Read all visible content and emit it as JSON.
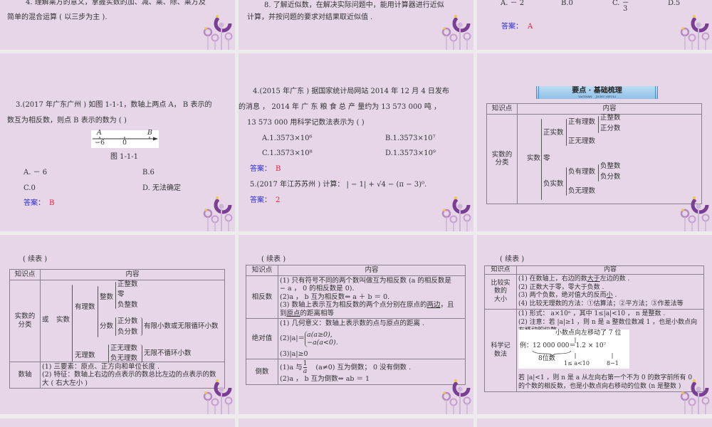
{
  "slide1": {
    "line1": "4. 理解乘方的意义，掌握实数的加、减、乘、除、乘方及",
    "line2": "简单的混合运算 ( 以三步为主 )."
  },
  "slide2": {
    "line1": "8. 了解近似数，在解决实际问题中，能用计算器进行近似",
    "line2": "计算，并按问题的要求对结果取近似值 ."
  },
  "slide3": {
    "optA": "A. － 2",
    "optB": "B.0",
    "optC": "C. －",
    "optC_den": "3",
    "optD": "D.5",
    "answer_label": "答案：",
    "answer": "A"
  },
  "slide4": {
    "q1": "3.(2017  年广东广州 ) 如图   1-1-1，数轴上两点   A， B  表示的",
    "q2": "数互为相反数，则点   B  表示的数为 (    )",
    "fig_A": "A",
    "fig_B": "B",
    "fig_m6": "−6",
    "fig_0": "0",
    "caption": "图   1-1-1",
    "optA": "A. － 6",
    "optB": "B.6",
    "optC": "C.0",
    "optD": "D. 无法确定",
    "answer_label": "答案：",
    "answer": "B"
  },
  "slide5": {
    "q1": "4.(2015  年广东 ) 据国家统计局网站   2014  年   12  月   4  日发布",
    "q2": "的消息 ，   2014  年  广  东  粮  食  总  产  量约为   13 573 000  吨 ，",
    "q3": "13 573 000  用科学记数法表示为 (       )",
    "optA": "A.1.3573×10⁶",
    "optB": "B.1.3573×10⁷",
    "optC": "C.1.3573×10⁸",
    "optD": "D.1.3573×10⁹",
    "answer_label": "答案：",
    "answer": "B",
    "q5": "5.(2017  年江苏苏州 ) 计算：  | − 1| + √4    − (π − 3)⁰.",
    "answer5": "2"
  },
  "slide6": {
    "banner": "要点 · 基础梳理",
    "banner_sub1": "YAODIAN",
    "banner_sub2": "JICHU SHULI",
    "h1": "知识点",
    "h2": "内容",
    "row": "实数的\n分类",
    "real": "实数",
    "pos": "正实数",
    "zero": "零",
    "neg": "负实数",
    "posrat": "正有理数",
    "posint": "正整数",
    "posfrac": "正分数",
    "posirr": "正无理数",
    "negrat": "负有理数",
    "negint": "负整数",
    "negfrac": "负分数",
    "negirr": "负无理数"
  },
  "slide7": {
    "cont": "( 续表 )",
    "h1": "知识点",
    "h2": "内容",
    "row1": "实数的\n分类",
    "or": "或",
    "real": "实数",
    "rat": "有理数",
    "int": "整数",
    "posint": "正整数",
    "zero": "零",
    "negint": "负整数",
    "frac": "分数",
    "posfrac": "正分数",
    "negfrac": "负分数",
    "finite": "有限小数或无限循环小数",
    "irr": "无理数",
    "posirr": "正无理数",
    "negirr": "负无理数",
    "infinite": "无限不循环小数",
    "row2": "数轴",
    "l1": "(1) 三要素：原点、正方向和单位长度 .",
    "l2": "(2) 特征：数轴上右边的点表示的数总比左边的点表示的数",
    "l3": "大 ( 右大左小 )"
  },
  "slide8": {
    "cont": "( 续表 )",
    "h1": "知识点",
    "h2": "内容",
    "r1": "相反数",
    "r1l1": "(1) 只有符号不同的两个数叫做互为相反数 (a  的相反数是",
    "r1l2": "  − a ， 0  的相反数是   0).",
    "r1l3": "(2)a ，  b  互为相反数⇔ a ＋ b ＝ 0.",
    "r1l4a": "(3) 数轴上表示互为相反数的两个点分别在原点的",
    "r1l4u": "两边",
    "r1l4b": "，且",
    "r1l5a": "到",
    "r1l5u": "原点",
    "r1l5b": "的距离相等",
    "r2": "绝对值",
    "r2l1": "(1) 几何意义：数轴上表示数的点与原点的距离 .",
    "r2l2": "(2)|a|＝",
    "r2c1": "a(a≥0),",
    "r2c2": "−a(a<0).",
    "r2l3": "(3)|a|≥0",
    "r3": "倒数",
    "r3l1a": "(1)a  与",
    "r3num": "1",
    "r3den": "a",
    "r3l1b": "(a≠0) 互为倒数；  0  没有倒数 .",
    "r3l2": "(2)a ，  b  互为倒数⇔ ab ＝ 1"
  },
  "slide9": {
    "cont": "( 续表 )",
    "h1": "知识点",
    "h2": "内容",
    "r1": "比较实\n数的\n大小",
    "r1l1a": "(1) 在数轴上，右边的数",
    "r1l1u": "大于",
    "r1l1b": "左边的数 .",
    "r1l2": "(2) 正数大于零，零大于负数 .",
    "r1l3a": "(3) 两个负数，绝对值大的反而",
    "r1l3u": "小",
    "r1l3b": " .",
    "r1l4": "(4) 比较无理数的方法：①估算法；②平方法；③作差法等",
    "r2": "科学记\n数法",
    "r2l1": "(1) 形式：  a×10ⁿ  ，其中   1≤|a|<10 ，  n  是整数 .",
    "r2l2": "(2) 注意：若 |a|≥1 ，则   n  是   a  整数位数减   1 ，也是小数点向",
    "r2l3": "右移动的位数 .",
    "ex_top": "小数点向左移动了 7 位",
    "ex_main": "例：12 000 000＝1.2   ×   10⁷",
    "ex_8": "8位数",
    "ex_range": "1≤ a<10",
    "ex_81": "8−1",
    "r2l4": "若 |a|<1 ，则   n  是   a  从左向右第一个不为   0  的数字前所有   0",
    "r2l5": "的个数的相反数，也是小数点向右移动的位数 (n  是整数 )"
  },
  "colors": {
    "panel": "#e6d6e8",
    "gap": "#ececec",
    "answer_label": "#2a2ad0",
    "answer": "#e0203a",
    "deco": "#7a3e94"
  }
}
